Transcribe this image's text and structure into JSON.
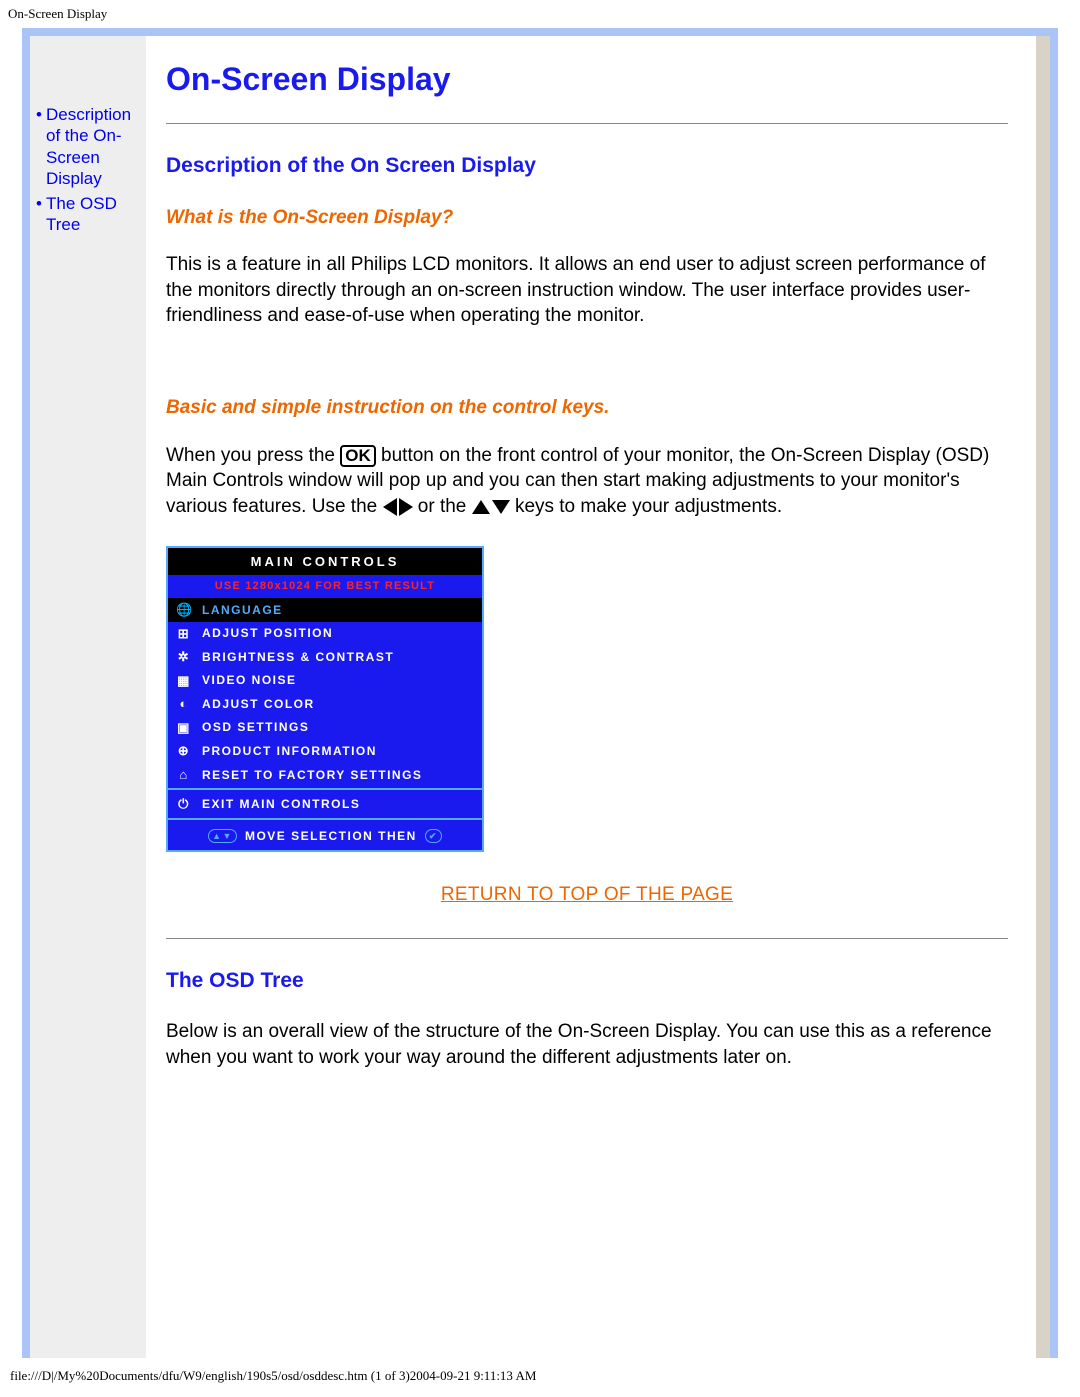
{
  "header": {
    "title_small": "On-Screen Display"
  },
  "sidebar": {
    "items": [
      {
        "label": "Description of the On-Screen Display"
      },
      {
        "label": "The OSD Tree"
      }
    ]
  },
  "main": {
    "page_title": "On-Screen Display",
    "section1": {
      "heading": "Description of the On Screen Display",
      "sub1": "What is the On-Screen Display?",
      "para1": "This is a feature in all Philips LCD monitors. It allows an end user to adjust screen performance of the monitors directly through an on-screen instruction window. The user interface provides user-friendliness and ease-of-use when operating the monitor.",
      "sub2": "Basic and simple instruction on the control keys.",
      "para2_a": "When you press the ",
      "para2_b": " button on the front control of your monitor, the On-Screen Display (OSD) Main Controls window will pop up and you can then start making adjustments to your monitor's various features. Use the ",
      "para2_c": " or the ",
      "para2_d": " keys to make your adjustments.",
      "ok_label": "OK"
    },
    "osd": {
      "title": "MAIN CONTROLS",
      "warn": "USE 1280x1024 FOR BEST RESULT",
      "items": [
        {
          "icon": "🌐",
          "label": "LANGUAGE",
          "hi": true
        },
        {
          "icon": "⊞",
          "label": "ADJUST POSITION"
        },
        {
          "icon": "✲",
          "label": "BRIGHTNESS & CONTRAST"
        },
        {
          "icon": "▦",
          "label": "VIDEO NOISE"
        },
        {
          "icon": "◐",
          "label": "ADJUST COLOR"
        },
        {
          "icon": "▣",
          "label": "OSD SETTINGS"
        },
        {
          "icon": "⊕",
          "label": "PRODUCT INFORMATION"
        },
        {
          "icon": "⌂",
          "label": "RESET TO FACTORY SETTINGS"
        }
      ],
      "exit": {
        "icon": "⏻",
        "label": "EXIT MAIN CONTROLS"
      },
      "foot": {
        "left_badge": "▲▼",
        "label": "MOVE SELECTION THEN",
        "right_badge": "✔"
      }
    },
    "return_link": "RETURN TO TOP OF THE PAGE",
    "section2": {
      "heading": "The OSD Tree",
      "para1": "Below is an overall view of the structure of the On-Screen Display. You can use this as a reference when you want to work your way around the different adjustments later on."
    }
  },
  "footer": {
    "path": "file:///D|/My%20Documents/dfu/W9/english/190s5/osd/osddesc.htm (1 of 3)2004-09-21 9:11:13 AM"
  }
}
